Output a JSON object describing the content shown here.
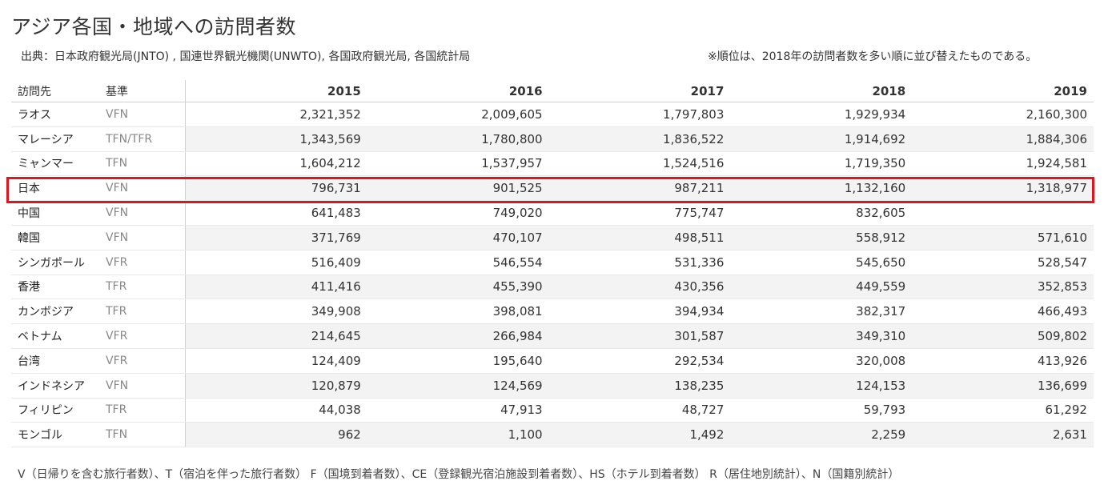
{
  "title": "アジア各国・地域への訪問者数",
  "source": "出典：日本政府観光局(JNTO) , 国連世界観光機関(UNWTO), 各国政府観光局, 各国統計局",
  "note": "※順位は、2018年の訪問者数を多い順に並び替えたものである。",
  "columns": {
    "destination": "訪問先",
    "basis": "基準",
    "years": [
      "2015",
      "2016",
      "2017",
      "2018",
      "2019"
    ]
  },
  "rows": [
    {
      "destination": "ラオス",
      "basis": "VFN",
      "values": [
        "2,321,352",
        "2,009,605",
        "1,797,803",
        "1,929,934",
        "2,160,300"
      ]
    },
    {
      "destination": "マレーシア",
      "basis": "TFN/TFR",
      "values": [
        "1,343,569",
        "1,780,800",
        "1,836,522",
        "1,914,692",
        "1,884,306"
      ]
    },
    {
      "destination": "ミャンマー",
      "basis": "TFN",
      "values": [
        "1,604,212",
        "1,537,957",
        "1,524,516",
        "1,719,350",
        "1,924,581"
      ]
    },
    {
      "destination": "日本",
      "basis": "VFN",
      "values": [
        "796,731",
        "901,525",
        "987,211",
        "1,132,160",
        "1,318,977"
      ]
    },
    {
      "destination": "中国",
      "basis": "VFN",
      "values": [
        "641,483",
        "749,020",
        "775,747",
        "832,605",
        ""
      ]
    },
    {
      "destination": "韓国",
      "basis": "VFN",
      "values": [
        "371,769",
        "470,107",
        "498,511",
        "558,912",
        "571,610"
      ]
    },
    {
      "destination": "シンガポール",
      "basis": "VFR",
      "values": [
        "516,409",
        "546,554",
        "531,336",
        "545,650",
        "528,547"
      ]
    },
    {
      "destination": "香港",
      "basis": "TFR",
      "values": [
        "411,416",
        "455,390",
        "430,356",
        "449,559",
        "352,853"
      ]
    },
    {
      "destination": "カンボジア",
      "basis": "TFR",
      "values": [
        "349,908",
        "398,081",
        "394,934",
        "382,317",
        "466,493"
      ]
    },
    {
      "destination": "ベトナム",
      "basis": "VFR",
      "values": [
        "214,645",
        "266,984",
        "301,587",
        "349,310",
        "509,802"
      ]
    },
    {
      "destination": "台湾",
      "basis": "VFR",
      "values": [
        "124,409",
        "195,640",
        "292,534",
        "320,008",
        "413,926"
      ]
    },
    {
      "destination": "インドネシア",
      "basis": "VFN",
      "values": [
        "120,879",
        "124,569",
        "138,235",
        "124,153",
        "136,699"
      ]
    },
    {
      "destination": "フィリピン",
      "basis": "TFR",
      "values": [
        "44,038",
        "47,913",
        "48,727",
        "59,793",
        "61,292"
      ]
    },
    {
      "destination": "モンゴル",
      "basis": "TFN",
      "values": [
        "962",
        "1,100",
        "1,492",
        "2,259",
        "2,631"
      ]
    }
  ],
  "highlight_color": "#e0161e",
  "footer": "V（日帰りを含む旅行者数）、T（宿泊を伴った旅行者数） F（国境到着者数）、CE（登録観光宿泊施設到着者数）、HS（ホテル到着者数） R（居住地別統計）、N（国籍別統計）"
}
